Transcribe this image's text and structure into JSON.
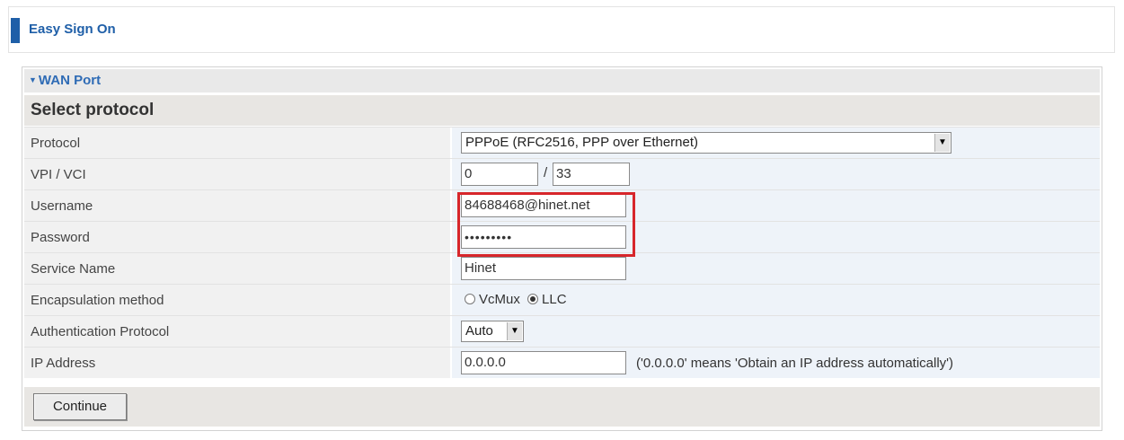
{
  "header": {
    "title": "Easy Sign On"
  },
  "panel": {
    "heading": "WAN Port",
    "section_title": "Select protocol"
  },
  "fields": {
    "protocol": {
      "label": "Protocol",
      "value": "PPPoE (RFC2516, PPP over Ethernet)"
    },
    "vpi_vci": {
      "label": "VPI / VCI",
      "vpi": "0",
      "separator": "/",
      "vci": "33"
    },
    "username": {
      "label": "Username",
      "value": "84688468@hinet.net"
    },
    "password": {
      "label": "Password",
      "masked": "•••••••••"
    },
    "service_name": {
      "label": "Service Name",
      "value": "Hinet"
    },
    "encapsulation": {
      "label": "Encapsulation method",
      "options": [
        "VcMux",
        "LLC"
      ],
      "selected": "LLC"
    },
    "auth_protocol": {
      "label": "Authentication Protocol",
      "value": "Auto"
    },
    "ip_address": {
      "label": "IP Address",
      "value": "0.0.0.0",
      "hint": "('0.0.0.0' means 'Obtain an IP address automatically')"
    }
  },
  "actions": {
    "continue_label": "Continue"
  },
  "colors": {
    "brand": "#1f5fa8",
    "highlight": "#d7262b"
  }
}
